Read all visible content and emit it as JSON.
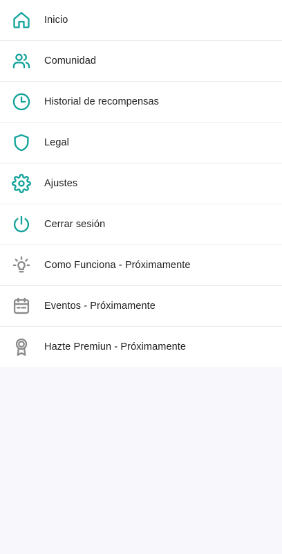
{
  "colors": {
    "accent": "#12a39a",
    "disabled_icon": "#8a8a8a",
    "text": "#1e1e1e",
    "background": "#f8f8fc",
    "panel": "#ffffff"
  },
  "menu": {
    "items": [
      {
        "label": "Inicio",
        "icon": "home-icon"
      },
      {
        "label": "Comunidad",
        "icon": "users-icon"
      },
      {
        "label": "Historial de recompensas",
        "icon": "clock-icon"
      },
      {
        "label": "Legal",
        "icon": "shield-icon"
      },
      {
        "label": "Ajustes",
        "icon": "gear-icon"
      },
      {
        "label": "Cerrar sesión",
        "icon": "power-icon"
      },
      {
        "label": "Como Funciona - Próximamente",
        "icon": "lightbulb-icon"
      },
      {
        "label": "Eventos - Próximamente",
        "icon": "calendar-icon"
      },
      {
        "label": "Hazte Premiun - Próximamente",
        "icon": "award-icon"
      }
    ]
  }
}
